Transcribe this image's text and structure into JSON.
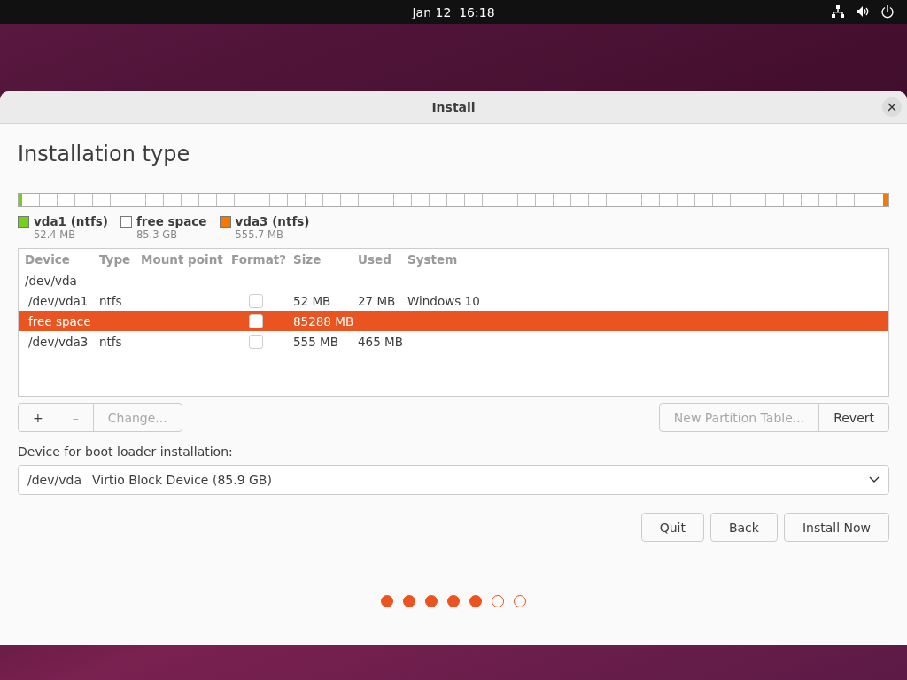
{
  "top_bar": {
    "clock": "Jan 12  16:18"
  },
  "window": {
    "title": "Install"
  },
  "heading": "Installation type",
  "partition_bar": {
    "segments": [
      {
        "name": "vda1 (ntfs)",
        "size": "52.4 MB",
        "color": "#73d216",
        "level": 0.004,
        "kind": "filled"
      },
      {
        "name": "free space",
        "size": "85.3 GB",
        "color": "#ffffff",
        "level": 0.99,
        "kind": "free"
      },
      {
        "name": "vda3 (ntfs)",
        "size": "555.7 MB",
        "color": "#f57900",
        "level": 0.006,
        "kind": "filled"
      }
    ]
  },
  "table": {
    "columns": [
      "Device",
      "Type",
      "Mount point",
      "Format?",
      "Size",
      "Used",
      "System"
    ],
    "rows": [
      {
        "kind": "disk",
        "device": "/dev/vda",
        "selected": false
      },
      {
        "kind": "partition",
        "device": "/dev/vda1",
        "type": "ntfs",
        "format": false,
        "size": "52 MB",
        "used": "27 MB",
        "system": "Windows 10",
        "selected": false
      },
      {
        "kind": "partition",
        "device": "free space",
        "format": false,
        "size": "85288 MB",
        "selected": true
      },
      {
        "kind": "partition",
        "device": "/dev/vda3",
        "type": "ntfs",
        "format": false,
        "size": "555 MB",
        "used": "465 MB",
        "selected": false
      }
    ]
  },
  "edit_buttons": [
    {
      "label": "+",
      "disabled": false
    },
    {
      "label": "–",
      "disabled": true
    },
    {
      "label": "Change...",
      "disabled": true
    }
  ],
  "table_buttons": [
    {
      "label": "New Partition Table...",
      "disabled": true
    },
    {
      "label": "Revert",
      "disabled": false
    }
  ],
  "boot_loader": {
    "label": "Device for boot loader installation:",
    "device": "/dev/vda",
    "description": "Virtio Block Device (85.9 GB)"
  },
  "buttons": [
    "Quit",
    "Back",
    "Install Now"
  ],
  "progress": [
    {
      "done": true
    },
    {
      "done": true
    },
    {
      "done": true
    },
    {
      "done": true
    },
    {
      "done": true
    },
    {
      "done": false
    },
    {
      "done": false
    }
  ]
}
